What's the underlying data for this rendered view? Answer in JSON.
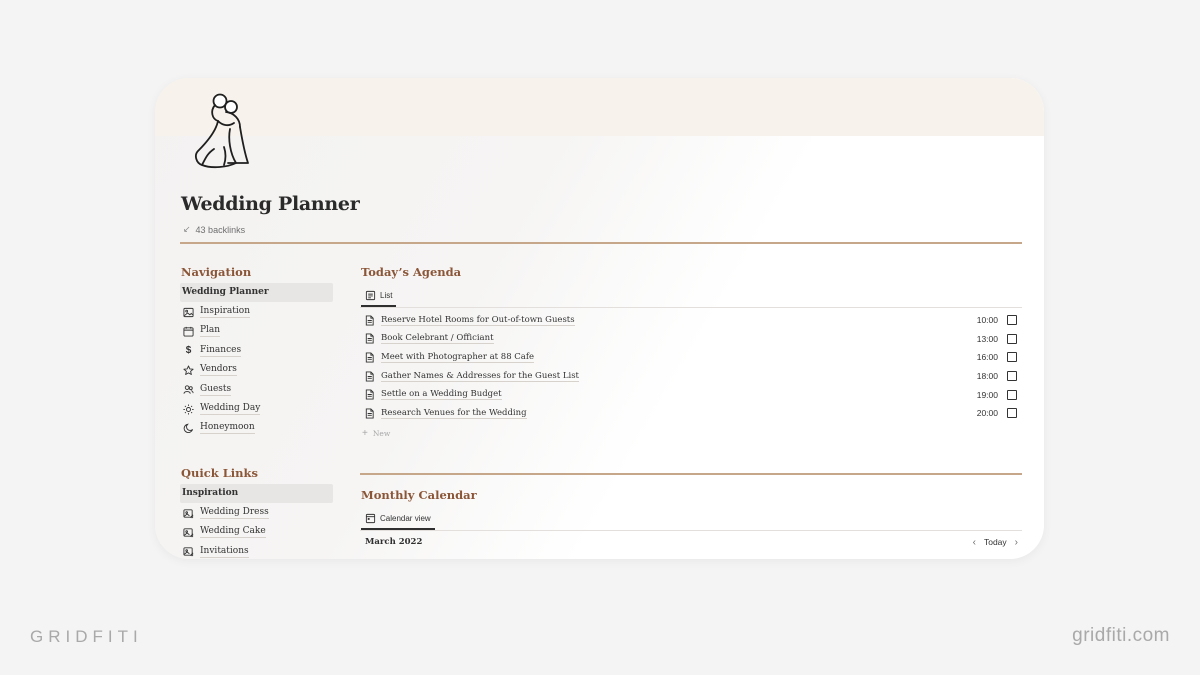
{
  "page": {
    "title": "Wedding Planner",
    "backlinks": "43 backlinks",
    "icon": "bride-and-groom-icon"
  },
  "navigation": {
    "heading": "Navigation",
    "items": [
      {
        "label": "Wedding Planner",
        "icon": "",
        "active": true
      },
      {
        "label": "Inspiration",
        "icon": "image-icon"
      },
      {
        "label": "Plan",
        "icon": "calendar-icon"
      },
      {
        "label": "Finances",
        "icon": "dollar-icon"
      },
      {
        "label": "Vendors",
        "icon": "star-icon"
      },
      {
        "label": "Guests",
        "icon": "people-icon"
      },
      {
        "label": "Wedding Day",
        "icon": "sun-icon"
      },
      {
        "label": "Honeymoon",
        "icon": "moon-icon"
      }
    ]
  },
  "quick_links": {
    "heading": "Quick Links",
    "items": [
      {
        "label": "Inspiration",
        "icon": "",
        "active": true
      },
      {
        "label": "Wedding Dress",
        "icon": "gallery-icon"
      },
      {
        "label": "Wedding Cake",
        "icon": "gallery-icon"
      },
      {
        "label": "Invitations",
        "icon": "gallery-icon"
      }
    ]
  },
  "agenda": {
    "heading": "Today’s Agenda",
    "view_label": "List",
    "rows": [
      {
        "title": "Reserve Hotel Rooms for Out-of-town Guests",
        "time": "10:00",
        "done": false
      },
      {
        "title": "Book Celebrant / Officiant",
        "time": "13:00",
        "done": false
      },
      {
        "title": "Meet with Photographer at 88 Cafe",
        "time": "16:00",
        "done": false
      },
      {
        "title": "Gather Names & Addresses for the Guest List",
        "time": "18:00",
        "done": false
      },
      {
        "title": "Settle on a Wedding Budget",
        "time": "19:00",
        "done": false
      },
      {
        "title": "Research Venues for the Wedding",
        "time": "20:00",
        "done": false
      }
    ],
    "new_label": "New"
  },
  "calendar": {
    "heading": "Monthly Calendar",
    "view_label": "Calendar view",
    "month": "March 2022",
    "today_label": "Today"
  },
  "branding": {
    "left": "GRIDFITI",
    "right": "gridfiti.com"
  },
  "colors": {
    "accent": "#8b5638",
    "divider": "#c7a78a",
    "cover": "#f7f3ec",
    "background": "#f4f4f4"
  }
}
